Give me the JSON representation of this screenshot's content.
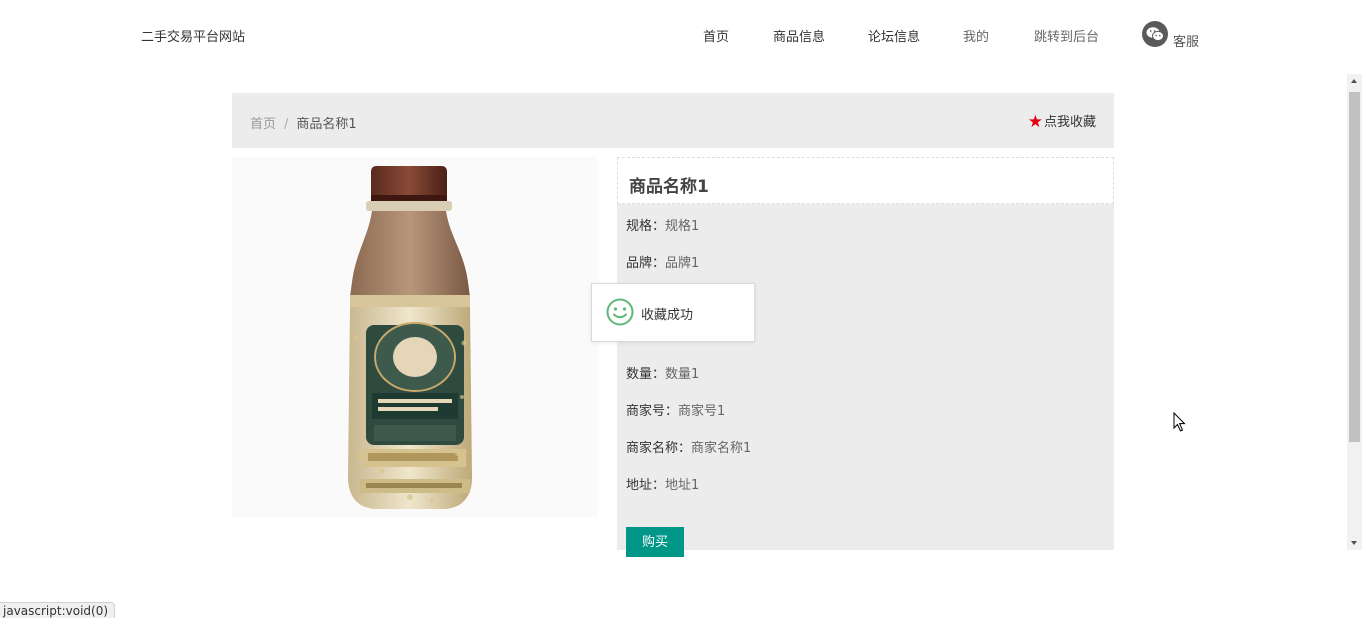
{
  "header": {
    "site_name": "二手交易平台网站",
    "nav": [
      {
        "label": "首页"
      },
      {
        "label": "商品信息"
      },
      {
        "label": "论坛信息"
      },
      {
        "label": "我的"
      },
      {
        "label": "跳转到后台"
      }
    ],
    "kefu_label": "客服"
  },
  "breadcrumb": {
    "home": "首页",
    "separator": "/",
    "current": "商品名称1"
  },
  "favorite": {
    "star": "★",
    "label": "点我收藏",
    "star_color": "#e60012"
  },
  "product": {
    "image_icon": "milk-coffee-bottle-image",
    "title": "商品名称1",
    "fields": [
      {
        "key": "规格：",
        "value": "规格1"
      },
      {
        "key": "品牌：",
        "value": "品牌1"
      },
      {
        "key": "数量：",
        "value": "数量1"
      },
      {
        "key": "商家号：",
        "value": "商家号1"
      },
      {
        "key": "商家名称：",
        "value": "商家名称1"
      },
      {
        "key": "地址：",
        "value": "地址1"
      }
    ],
    "buy_label": "购买",
    "buy_color": "#009688"
  },
  "toast": {
    "icon": "smile-icon",
    "message": "收藏成功",
    "icon_color": "#5fb878"
  },
  "status_bar": {
    "text": "javascript:void(0)"
  }
}
